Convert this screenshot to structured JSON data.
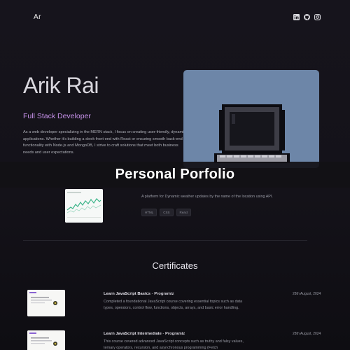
{
  "nav": {
    "logo": "Ar",
    "icons": [
      "linkedin-icon",
      "github-icon",
      "instagram-icon"
    ]
  },
  "hero": {
    "name": "Arik Rai",
    "role": "Full Stack Developer",
    "bio": "As a web developer specializing in the MERN stack, I focus on creating user-friendly, dynamic applications. Whether it's building a sleek front-end with React or ensuring smooth back-end functionality with Node.js and MongoDB, I strive to craft solutions that meet both business needs and user expectations.",
    "art": "pixel-computer-illustration"
  },
  "banner": {
    "text": "Personal Porfolio"
  },
  "project": {
    "description": "A platform for Dynamic weather updates by the name of the location using API.",
    "tags": [
      "HTML",
      "CSS",
      "React"
    ]
  },
  "certificates": {
    "title": "Certificates",
    "items": [
      {
        "title": "Learn JavaScript Basics",
        "separator": " - ",
        "provider": "Programiz",
        "date": "28th August, 2024",
        "description": "Completed a foundational JavaScript course covering essential topics such as data types, operators, control flow, functions, objects, arrays, and basic error handling."
      },
      {
        "title": "Learn JavaScript Intermediate",
        "separator": " - ",
        "provider": "Programiz",
        "date": "28th August, 2024",
        "description": "This course covered advanced JavaScript concepts such as truthy and falsy values, ternary operators, recursion, and asynchronous programming (Fetch"
      }
    ]
  },
  "colors": {
    "background": "#141219",
    "accent": "#c792ea",
    "art_background": "#6d86a8"
  }
}
